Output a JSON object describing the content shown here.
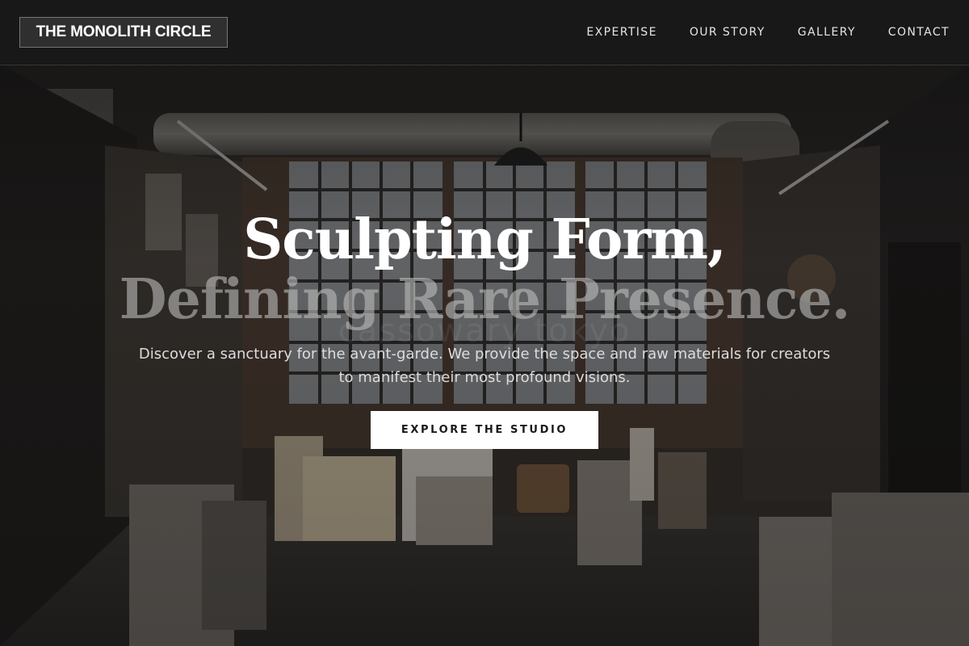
{
  "brand": {
    "logo_text": "THE MONOLITH CIRCLE"
  },
  "nav": {
    "items": [
      {
        "label": "EXPERTISE"
      },
      {
        "label": "OUR STORY"
      },
      {
        "label": "GALLERY"
      },
      {
        "label": "CONTACT"
      }
    ]
  },
  "hero": {
    "headline_line1": "Sculpting Form,",
    "headline_line2": "Defining Rare Presence.",
    "background_ghost_text": "cassowary tokyo",
    "subtitle": "Discover a sanctuary for the avant-garde. We provide the space and raw materials for creators to manifest their most profound visions.",
    "cta_label": "EXPLORE THE STUDIO"
  },
  "colors": {
    "header_bg": "#181818",
    "cta_bg": "#ffffff",
    "cta_text": "#1a1a1a",
    "headline_primary": "#ffffff",
    "headline_secondary": "#b9b9b9"
  }
}
